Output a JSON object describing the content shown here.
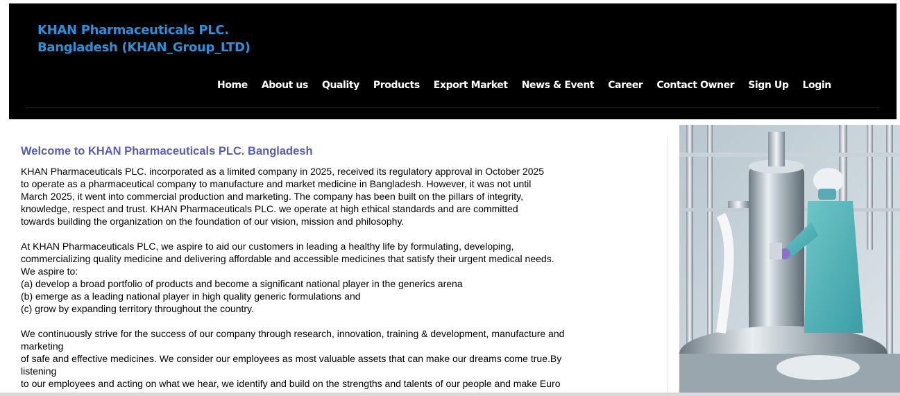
{
  "header": {
    "brand_line1": "KHAN Pharmaceuticals PLC.",
    "brand_line2": "Bangladesh (KHAN_Group_LTD)",
    "brand_color": "#2f8fd8",
    "nav": [
      {
        "label": "Home"
      },
      {
        "label": "About us"
      },
      {
        "label": "Quality"
      },
      {
        "label": "Products"
      },
      {
        "label": "Export Market"
      },
      {
        "label": "News & Event"
      },
      {
        "label": "Career"
      },
      {
        "label": "Contact Owner"
      },
      {
        "label": "Sign Up"
      },
      {
        "label": "Login"
      }
    ]
  },
  "content": {
    "title": "Welcome to KHAN Pharmaceuticals PLC. Bangladesh",
    "title_color": "#5b5bb8",
    "para1": [
      "KHAN Pharmaceuticals PLC. incorporated as a limited company in 2025, received its regulatory approval in October 2025",
      "to operate as a pharmaceutical company to manufacture and market medicine in Bangladesh. However, it was not until",
      "March 2025, it went into commercial production and marketing. The company has been built on the pillars of integrity,",
      "knowledge, respect and trust. KHAN Pharmaceuticals PLC. we operate at high ethical standards and are committed",
      "towards building the organization on the foundation of our vision, mission and philosophy."
    ],
    "para2": [
      "At KHAN Pharmaceuticals PLC, we aspire to aid our customers in leading a healthy life by formulating, developing,",
      "commercializing quality medicine and delivering affordable and accessible medicines that satisfy their urgent medical needs.",
      "We aspire to:",
      "(a) develop a broad portfolio of products and become a significant national player in the generics arena",
      "(b) emerge as a leading national player in high quality generic formulations and",
      "(c) grow by expanding territory throughout the country."
    ],
    "para3": [
      "We continuously strive for the success of our company through research, innovation, training & development, manufacture and",
      "marketing",
      "of safe and effective medicines. We consider our employees as most valuable assets that can make our dreams come true.By",
      "listening",
      "to our employees and acting on what we hear, we identify and build on the strengths and talents of our people and make Euro"
    ]
  },
  "image": {
    "name": "pharmaceutical-lab-photo"
  }
}
